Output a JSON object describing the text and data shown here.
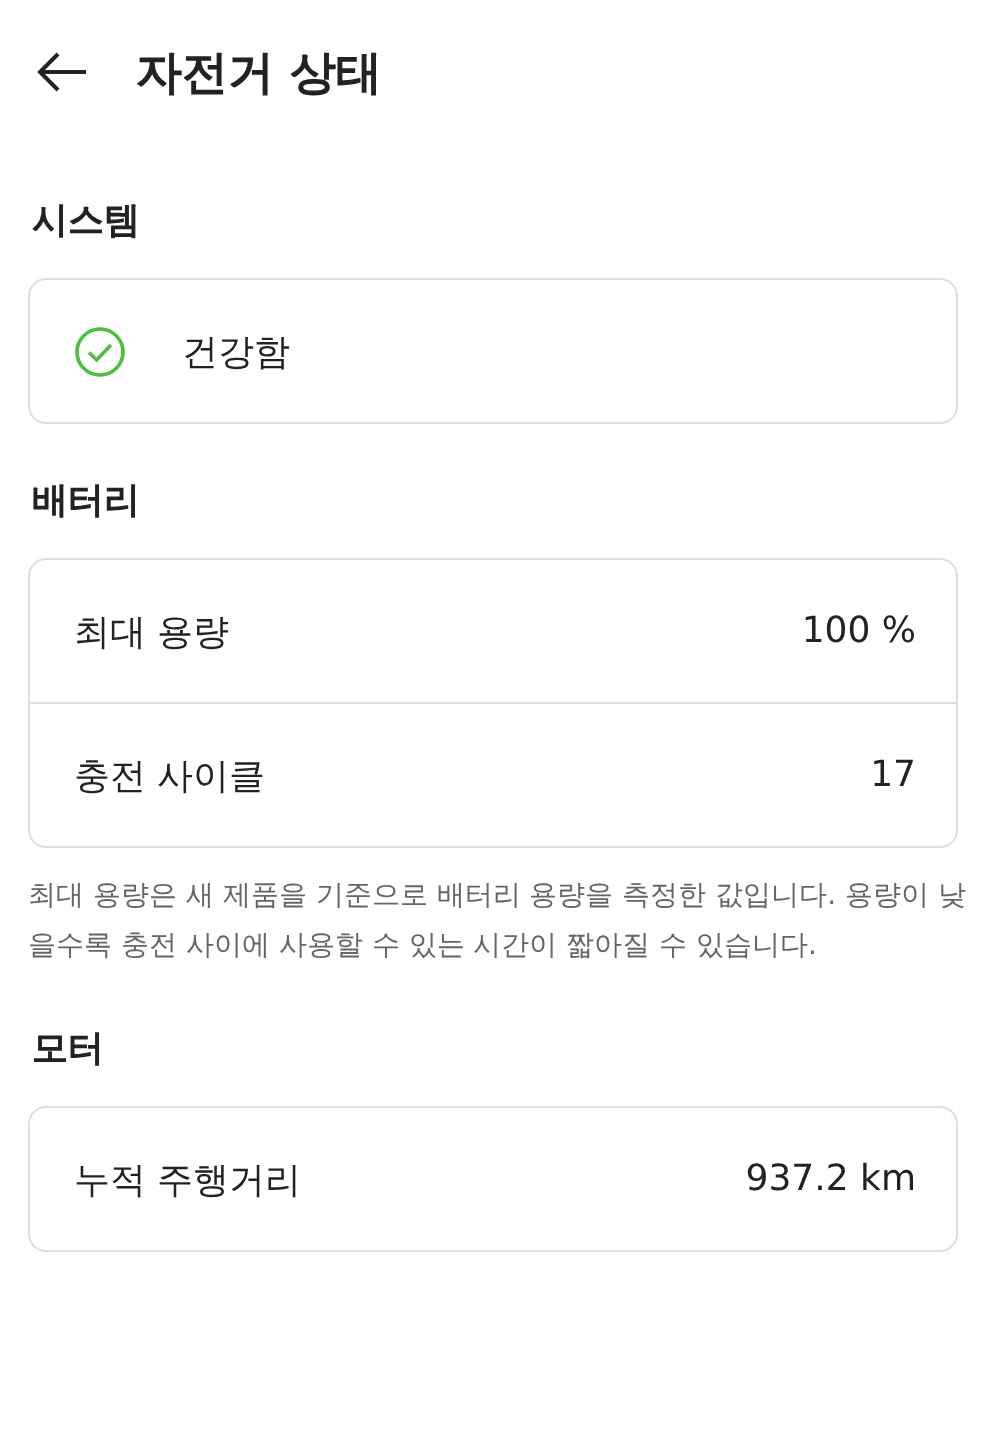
{
  "header": {
    "title": "자전거 상태"
  },
  "sections": [
    {
      "label": "시스템",
      "rows": [
        {
          "kind": "status",
          "label": "건강함"
        }
      ]
    },
    {
      "label": "배터리",
      "rows": [
        {
          "kind": "value",
          "label": "최대 용량",
          "value": "100 %"
        },
        {
          "kind": "value",
          "label": "충전 사이클",
          "value": "17"
        }
      ],
      "note": "최대 용량은 새 제품을 기준으로 배터리 용량을 측정한 값입니다. 용량이 낮을수록 충전 사이에 사용할 수 있는 시간이 짧아질 수 있습니다."
    },
    {
      "label": "모터",
      "rows": [
        {
          "kind": "value",
          "label": "누적 주행거리",
          "value": "937.2 km"
        }
      ]
    }
  ]
}
